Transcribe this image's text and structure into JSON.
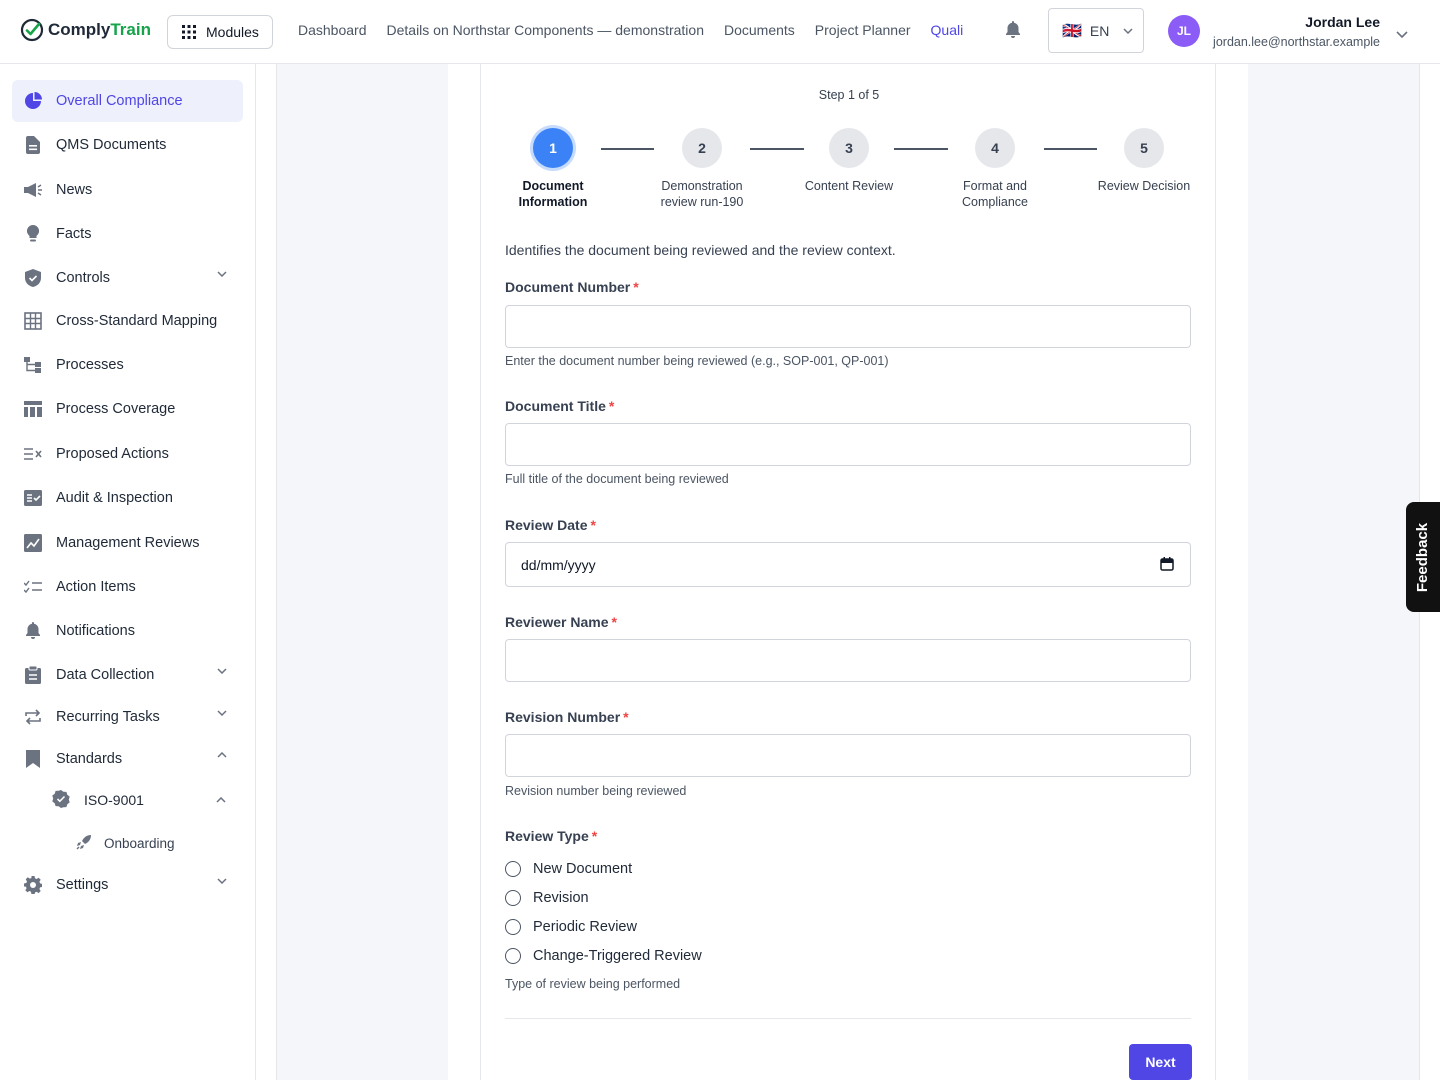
{
  "header": {
    "logo_part1": "Comply",
    "logo_part2": "Train",
    "modules_label": "Modules",
    "nav": [
      "Dashboard",
      "Details on Northstar Components — demonstration",
      "Documents",
      "Project Planner",
      "Quali"
    ],
    "active_nav": "Quali",
    "lang": "EN",
    "flag": "🇬🇧",
    "user_initials": "JL",
    "user_name": "Jordan Lee",
    "user_email": "jordan.lee@northstar.example"
  },
  "sidebar": {
    "items": [
      {
        "label": "Overall Compliance",
        "icon": "pie-chart-icon",
        "active": true
      },
      {
        "label": "QMS Documents",
        "icon": "document-icon"
      },
      {
        "label": "News",
        "icon": "megaphone-icon"
      },
      {
        "label": "Facts",
        "icon": "lightbulb-icon"
      },
      {
        "label": "Controls",
        "icon": "shield-check-icon",
        "expandable": true
      },
      {
        "label": "Cross-Standard Mapping",
        "icon": "grid-icon"
      },
      {
        "label": "Processes",
        "icon": "process-tree-icon"
      },
      {
        "label": "Process Coverage",
        "icon": "table-icon"
      },
      {
        "label": "Proposed Actions",
        "icon": "list-x-icon"
      },
      {
        "label": "Audit & Inspection",
        "icon": "clipboard-check-icon"
      },
      {
        "label": "Management Reviews",
        "icon": "chart-box-icon"
      },
      {
        "label": "Action Items",
        "icon": "checklist-icon"
      },
      {
        "label": "Notifications",
        "icon": "bell-icon"
      },
      {
        "label": "Data Collection",
        "icon": "clipboard-icon",
        "expandable": true
      },
      {
        "label": "Recurring Tasks",
        "icon": "repeat-icon",
        "expandable": true
      },
      {
        "label": "Standards",
        "icon": "bookmark-icon",
        "expanded": true
      },
      {
        "label": "Settings",
        "icon": "gear-icon",
        "expandable": true
      }
    ],
    "standard_child": "ISO-9001",
    "standard_grandchild": "Onboarding"
  },
  "wizard": {
    "step_indicator": "Step 1 of 5",
    "steps": [
      {
        "num": "1",
        "label": "Document Information",
        "current": true
      },
      {
        "num": "2",
        "label": "Demonstration review run-190"
      },
      {
        "num": "3",
        "label": "Content Review"
      },
      {
        "num": "4",
        "label": "Format and Compliance"
      },
      {
        "num": "5",
        "label": "Review Decision"
      }
    ],
    "description": "Identifies the document being reviewed and the review context.",
    "fields": {
      "doc_number": {
        "label": "Document Number",
        "value": "",
        "help": "Enter the document number being reviewed (e.g., SOP-001, QP-001)"
      },
      "doc_title": {
        "label": "Document Title",
        "value": "",
        "help": "Full title of the document being reviewed"
      },
      "review_date": {
        "label": "Review Date",
        "placeholder": "dd/mm/yyyy"
      },
      "reviewer": {
        "label": "Reviewer Name",
        "value": ""
      },
      "revision": {
        "label": "Revision Number",
        "value": "",
        "help": "Revision number being reviewed"
      },
      "review_type": {
        "label": "Review Type",
        "options": [
          "New Document",
          "Revision",
          "Periodic Review",
          "Change-Triggered Review"
        ],
        "help": "Type of review being performed"
      }
    },
    "required_mark": "*",
    "next_label": "Next"
  },
  "feedback_label": "Feedback",
  "colors": {
    "accent": "#4f46e5",
    "step_current": "#3b82f6",
    "brand_green": "#16a34a",
    "required": "#ef4444"
  }
}
